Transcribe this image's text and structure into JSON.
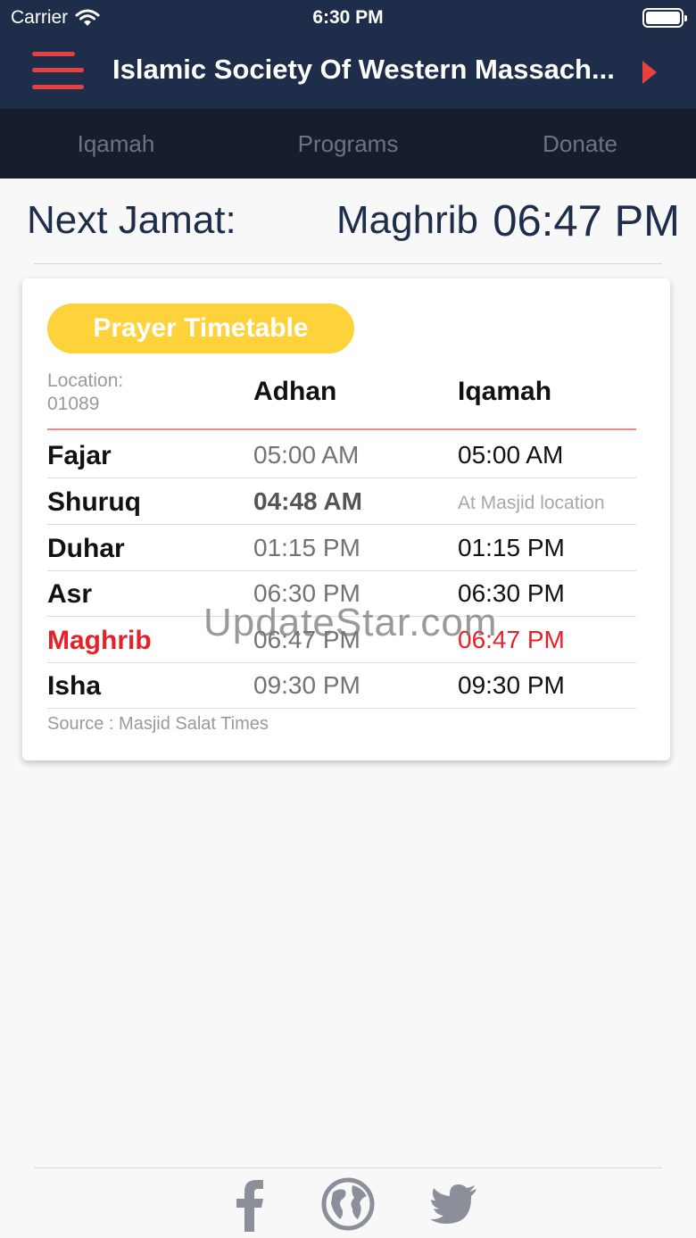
{
  "status_bar": {
    "carrier": "Carrier",
    "time": "6:30 PM"
  },
  "navbar": {
    "title": "Islamic Society Of Western Massach..."
  },
  "tabs": [
    {
      "label": "Iqamah"
    },
    {
      "label": "Programs"
    },
    {
      "label": "Donate"
    }
  ],
  "next_jamat": {
    "label": "Next Jamat:",
    "prayer": "Maghrib",
    "time": "06:47 PM"
  },
  "timetable": {
    "title": "Prayer Timetable",
    "location_label": "Location:",
    "location_value": "01089",
    "header_adhan": "Adhan",
    "header_iqamah": "Iqamah",
    "rows": [
      {
        "name": "Fajar",
        "adhan": "05:00 AM",
        "iqamah": "05:00 AM"
      },
      {
        "name": "Shuruq",
        "adhan": "04:48 AM",
        "iqamah": "At Masjid location"
      },
      {
        "name": "Duhar",
        "adhan": "01:15 PM",
        "iqamah": "01:15 PM"
      },
      {
        "name": "Asr",
        "adhan": "06:30 PM",
        "iqamah": "06:30 PM"
      },
      {
        "name": "Maghrib",
        "adhan": "06:47 PM",
        "iqamah": "06:47 PM"
      },
      {
        "name": "Isha",
        "adhan": "09:30 PM",
        "iqamah": "09:30 PM"
      }
    ],
    "source": "Source : Masjid Salat Times"
  },
  "watermark": "UpdateStar.com",
  "colors": {
    "navy": "#1e2d4a",
    "accent_red": "#e8403e",
    "highlight_red": "#e8202a",
    "pill_yellow": "#fdd23b"
  },
  "social_icons": [
    "facebook-icon",
    "globe-icon",
    "twitter-icon"
  ]
}
